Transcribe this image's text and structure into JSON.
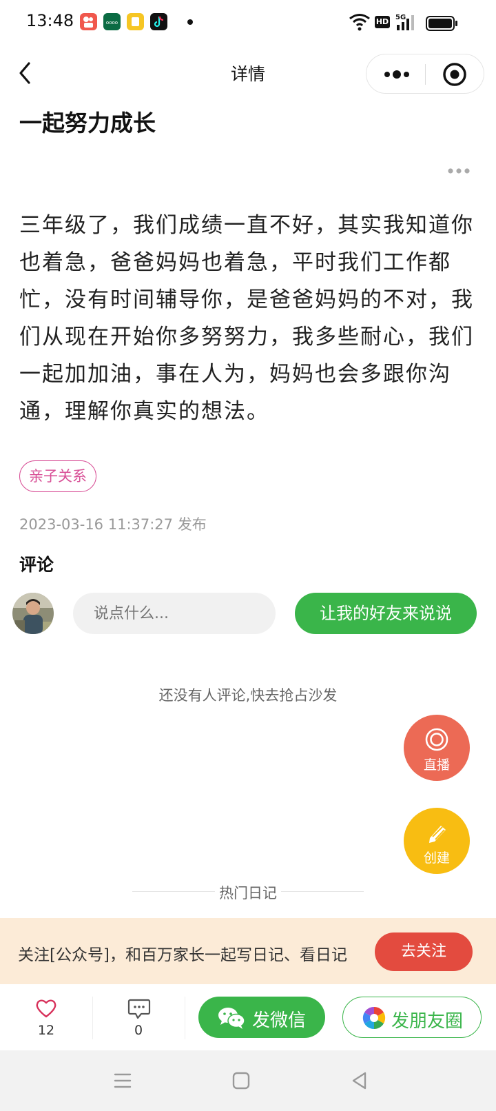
{
  "status_bar": {
    "time": "13:48",
    "app_icons": [
      "kuaishou-app-icon",
      "oppo-app-icon",
      "notes-app-icon",
      "tiktok-app-icon"
    ],
    "right_icons": [
      "wifi-icon",
      "hd-icon",
      "5g-signal-icon",
      "battery-icon"
    ],
    "hd_label": "HD",
    "network_label": "5G"
  },
  "nav": {
    "title": "详情"
  },
  "post": {
    "title": "一起努力成长",
    "body": "三年级了，我们成绩一直不好，其实我知道你也着急，爸爸妈妈也着急，平时我们工作都忙，没有时间辅导你，是爸爸妈妈的不对，我们从现在开始你多努努力，我多些耐心，我们一起加加油，事在人为，妈妈也会多跟你沟通，理解你真实的想法。",
    "tag": "亲子关系",
    "published": "2023-03-16 11:37:27 发布"
  },
  "comments": {
    "heading": "评论",
    "input_placeholder": "说点什么...",
    "invite_label": "让我的好友来说说",
    "empty_hint": "还没有人评论,快去抢占沙发"
  },
  "fab": {
    "live_label": "直播",
    "create_label": "创建"
  },
  "hot_section": {
    "title": "热门日记"
  },
  "follow_banner": {
    "text": "关注[公众号]，和百万家长一起写日记、看日记",
    "button": "去关注"
  },
  "action_bar": {
    "likes": "12",
    "comments": "0",
    "wechat_label": "发微信",
    "moments_label": "发朋友圈"
  },
  "colors": {
    "green": "#3ab54a",
    "tag_pink": "#d84f96",
    "live_red": "#ec6a55",
    "create_yellow": "#f8bd12",
    "banner_bg": "#fcebd7",
    "follow_red": "#e34b3f"
  }
}
